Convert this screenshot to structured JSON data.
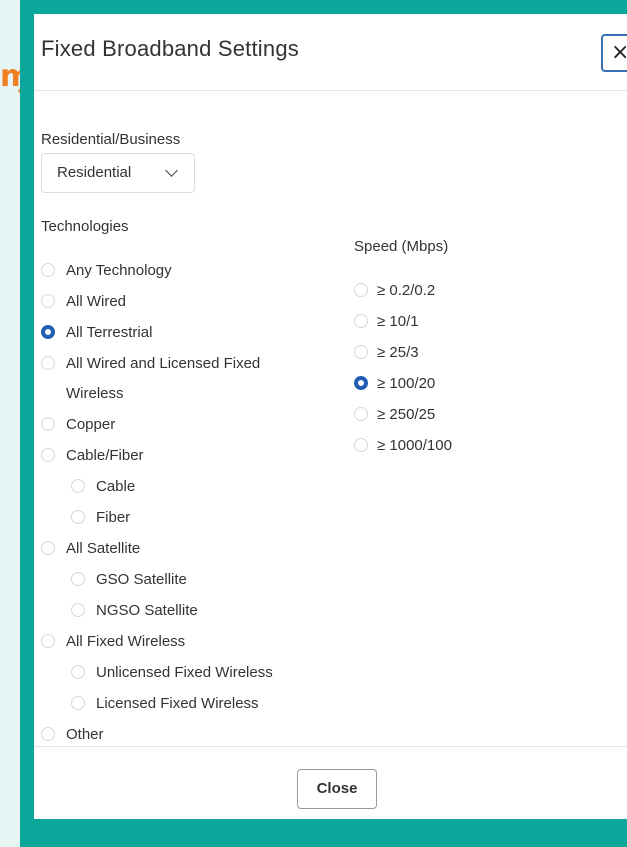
{
  "dialog": {
    "title": "Fixed Broadband Settings",
    "close_glyph": "×",
    "close_label": "Close"
  },
  "residential": {
    "label": "Residential/Business",
    "selected": "Residential"
  },
  "technologies": {
    "label": "Technologies",
    "options": [
      {
        "label": "Any Technology",
        "checked": false,
        "indent": 0
      },
      {
        "label": "All Wired",
        "checked": false,
        "indent": 0
      },
      {
        "label": "All Terrestrial",
        "checked": true,
        "indent": 0
      },
      {
        "label": "All Wired and Licensed Fixed Wireless",
        "checked": false,
        "indent": 0
      },
      {
        "label": "Copper",
        "checked": false,
        "indent": 0
      },
      {
        "label": "Cable/Fiber",
        "checked": false,
        "indent": 0
      },
      {
        "label": "Cable",
        "checked": false,
        "indent": 1
      },
      {
        "label": "Fiber",
        "checked": false,
        "indent": 1
      },
      {
        "label": "All Satellite",
        "checked": false,
        "indent": 0
      },
      {
        "label": "GSO Satellite",
        "checked": false,
        "indent": 1
      },
      {
        "label": "NGSO Satellite",
        "checked": false,
        "indent": 1
      },
      {
        "label": "All Fixed Wireless",
        "checked": false,
        "indent": 0
      },
      {
        "label": "Unlicensed Fixed Wireless",
        "checked": false,
        "indent": 1
      },
      {
        "label": "Licensed Fixed Wireless",
        "checked": false,
        "indent": 1
      },
      {
        "label": "Other",
        "checked": false,
        "indent": 0
      }
    ]
  },
  "speed": {
    "label": "Speed (Mbps)",
    "options": [
      {
        "label": "≥ 0.2/0.2",
        "checked": false
      },
      {
        "label": "≥ 10/1",
        "checked": false
      },
      {
        "label": "≥ 25/3",
        "checked": false
      },
      {
        "label": "≥ 100/20",
        "checked": true
      },
      {
        "label": "≥ 250/25",
        "checked": false
      },
      {
        "label": "≥ 1000/100",
        "checked": false
      }
    ]
  },
  "colors": {
    "frame": "#0aa79a",
    "accent": "#f07f22",
    "radio_checked": "#1f5fb3"
  }
}
